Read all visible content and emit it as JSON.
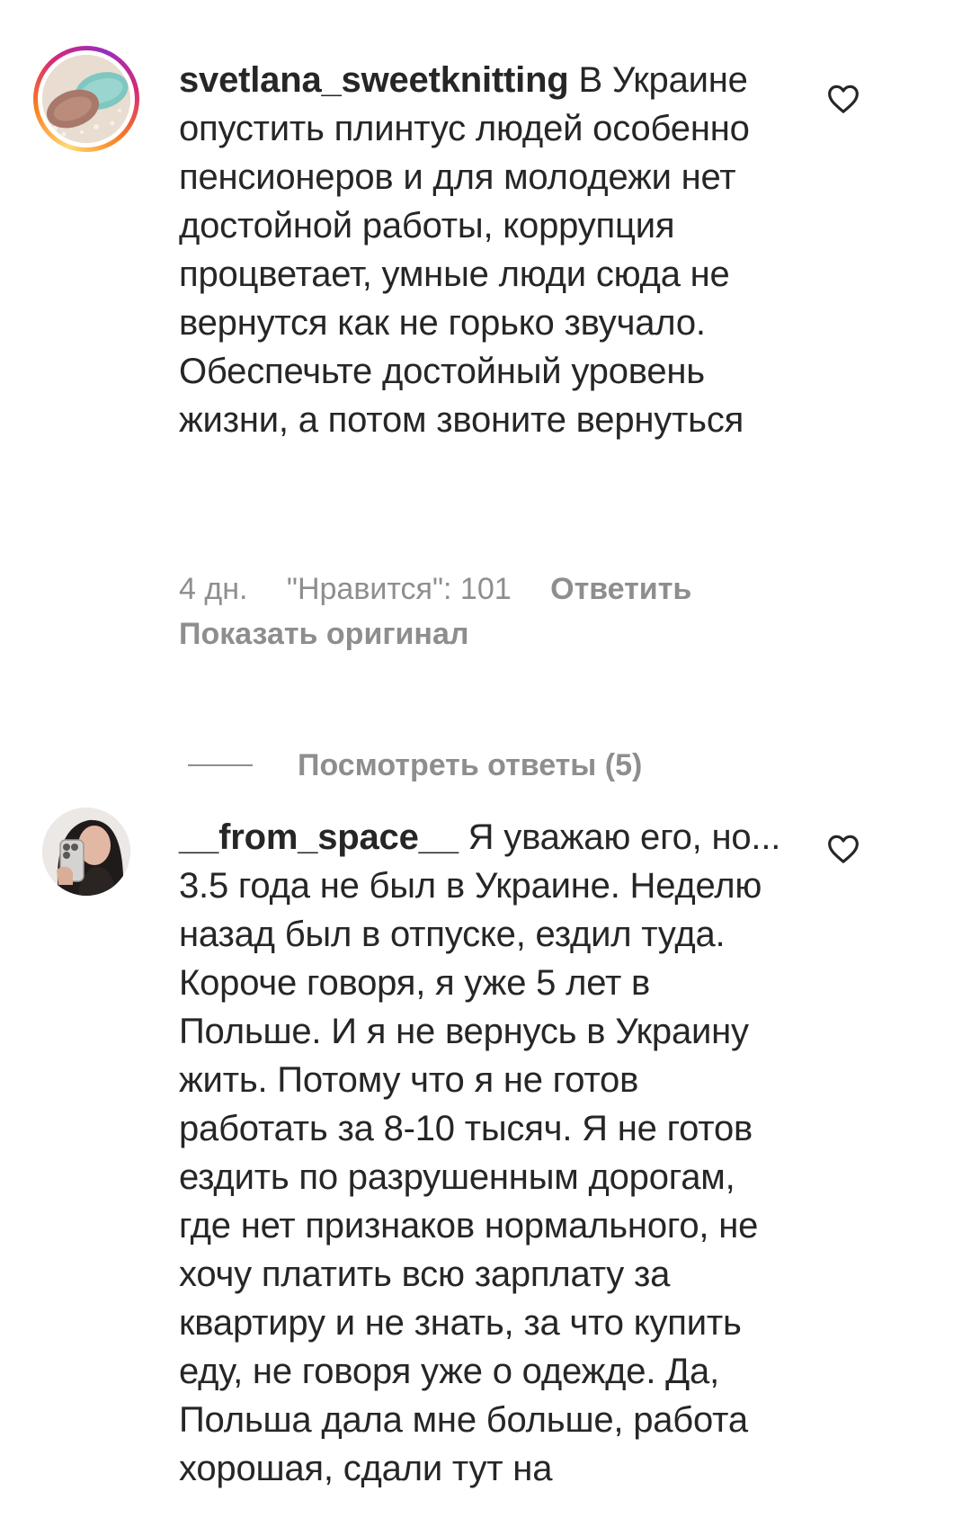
{
  "comments": [
    {
      "username": "svetlana_sweetknitting",
      "text": "В Украине опустить плинтус людей особенно пенсионеров и для молодежи нет достойной работы, коррупция процветает, умные люди сюда не вернутся как не горько звучало. Обеспечьте достойный уровень жизни, а потом звоните вернуться",
      "age": "4 дн.",
      "likes": "\"Нравится\": 101",
      "reply_label": "Ответить",
      "show_original_label": "Показать оригинал",
      "view_replies_label": "Посмотреть ответы (5)",
      "has_story_ring": true,
      "like_icon": "heart-outline-icon"
    },
    {
      "username": "__from_space__",
      "text": "Я уважаю его, но... 3.5 года не был в Украине. Неделю назад был в отпуске, ездил туда. Короче говоря, я уже 5 лет в Польше. И я не вернусь в Украину жить. Потому что я не готов работать за 8-10 тысяч. Я не готов ездить по разрушенным дорогам, где нет признаков нормального, не хочу платить всю зарплату за квартиру и не знать, за что купить еду, не говоря уже о одежде. Да, Польша дала мне больше, работа хорошая, сдали тут на",
      "has_story_ring": false,
      "like_icon": "heart-outline-icon"
    }
  ],
  "colors": {
    "text": "#262626",
    "secondary": "#8e8e8e",
    "background": "#ffffff"
  }
}
